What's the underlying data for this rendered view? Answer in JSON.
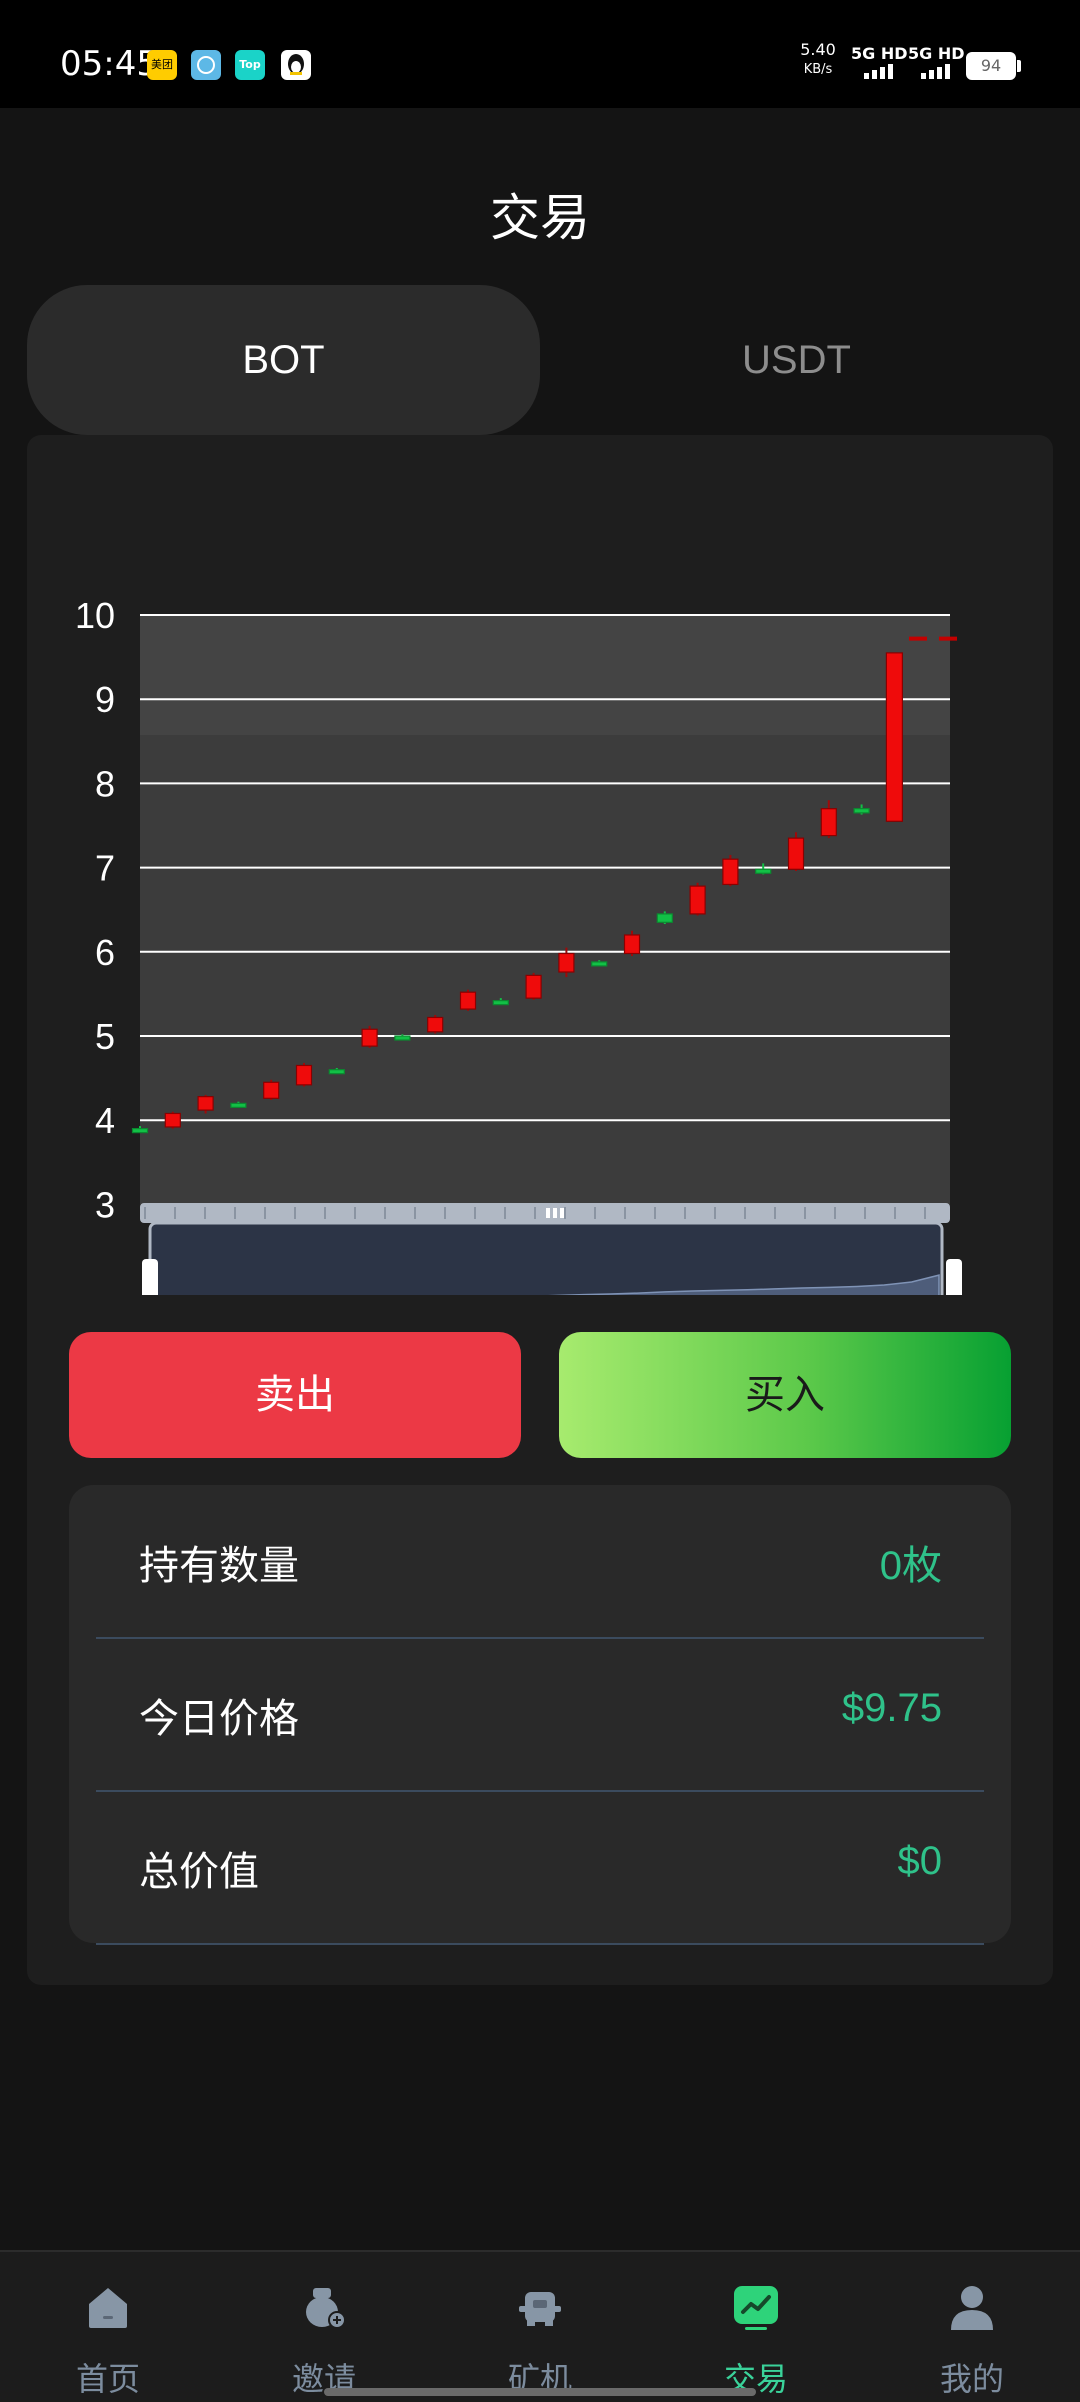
{
  "status_bar": {
    "time": "05:45",
    "apps": [
      "美团",
      "",
      "Top",
      ""
    ],
    "net_speed": "5.40",
    "net_unit": "KB/s",
    "signal1": "5G HD",
    "signal2": "5G HD",
    "battery": "94"
  },
  "header": {
    "title": "交易"
  },
  "tabs": [
    {
      "label": "BOT",
      "active": true
    },
    {
      "label": "USDT",
      "active": false
    }
  ],
  "chart_data": {
    "type": "candlestick",
    "title": "",
    "xlabel": "",
    "ylabel": "",
    "ylim": [
      3,
      10
    ],
    "yticks": [
      10,
      9,
      8,
      7,
      6,
      5,
      4,
      3
    ],
    "grid": true,
    "candles": [
      {
        "open": 3.88,
        "close": 3.9,
        "low": 3.86,
        "high": 3.93,
        "dir": "up"
      },
      {
        "open": 3.92,
        "close": 4.08,
        "low": 3.9,
        "high": 4.1,
        "dir": "down"
      },
      {
        "open": 4.12,
        "close": 4.28,
        "low": 4.08,
        "high": 4.3,
        "dir": "down"
      },
      {
        "open": 4.18,
        "close": 4.2,
        "low": 4.17,
        "high": 4.22,
        "dir": "up"
      },
      {
        "open": 4.26,
        "close": 4.45,
        "low": 4.24,
        "high": 4.48,
        "dir": "down"
      },
      {
        "open": 4.42,
        "close": 4.65,
        "low": 4.4,
        "high": 4.68,
        "dir": "down"
      },
      {
        "open": 4.58,
        "close": 4.6,
        "low": 4.57,
        "high": 4.62,
        "dir": "up"
      },
      {
        "open": 4.88,
        "close": 5.08,
        "low": 4.86,
        "high": 5.12,
        "dir": "down"
      },
      {
        "open": 4.98,
        "close": 5.0,
        "low": 4.97,
        "high": 5.02,
        "dir": "up"
      },
      {
        "open": 5.05,
        "close": 5.22,
        "low": 5.03,
        "high": 5.25,
        "dir": "down"
      },
      {
        "open": 5.32,
        "close": 5.52,
        "low": 5.3,
        "high": 5.55,
        "dir": "down"
      },
      {
        "open": 5.4,
        "close": 5.42,
        "low": 5.39,
        "high": 5.45,
        "dir": "up"
      },
      {
        "open": 5.45,
        "close": 5.72,
        "low": 5.43,
        "high": 5.75,
        "dir": "down"
      },
      {
        "open": 5.76,
        "close": 5.98,
        "low": 5.7,
        "high": 6.05,
        "dir": "down"
      },
      {
        "open": 5.85,
        "close": 5.88,
        "low": 5.84,
        "high": 5.9,
        "dir": "up"
      },
      {
        "open": 5.98,
        "close": 6.2,
        "low": 5.95,
        "high": 6.25,
        "dir": "down"
      },
      {
        "open": 6.35,
        "close": 6.45,
        "low": 6.33,
        "high": 6.48,
        "dir": "up"
      },
      {
        "open": 6.45,
        "close": 6.78,
        "low": 6.43,
        "high": 6.82,
        "dir": "down"
      },
      {
        "open": 6.8,
        "close": 7.1,
        "low": 6.78,
        "high": 7.15,
        "dir": "down"
      },
      {
        "open": 6.95,
        "close": 6.98,
        "low": 6.92,
        "high": 7.05,
        "dir": "up"
      },
      {
        "open": 6.98,
        "close": 7.35,
        "low": 6.96,
        "high": 7.42,
        "dir": "down"
      },
      {
        "open": 7.38,
        "close": 7.7,
        "low": 7.35,
        "high": 7.8,
        "dir": "down"
      },
      {
        "open": 7.65,
        "close": 7.7,
        "low": 7.63,
        "high": 7.75,
        "dir": "up"
      },
      {
        "open": 7.55,
        "close": 9.55,
        "low": 7.55,
        "high": 9.55,
        "dir": "down"
      }
    ],
    "last_price_marker": 9.72,
    "overview_series": [
      0.02,
      0.03,
      0.05,
      0.07,
      0.08,
      0.1,
      0.11,
      0.14,
      0.17,
      0.19,
      0.2,
      0.22,
      0.25,
      0.28,
      0.3,
      0.33,
      0.37,
      0.4,
      0.42,
      0.44,
      0.47,
      0.5,
      0.52,
      0.55,
      0.6,
      0.7,
      0.93
    ]
  },
  "actions": {
    "sell_label": "卖出",
    "buy_label": "买入"
  },
  "info": {
    "rows": [
      {
        "label": "持有数量",
        "value": "0枚"
      },
      {
        "label": "今日价格",
        "value": "$9.75"
      },
      {
        "label": "总价值",
        "value": "$0"
      }
    ]
  },
  "nav": {
    "items": [
      {
        "label": "首页",
        "icon": "home-icon"
      },
      {
        "label": "邀请",
        "icon": "invite-icon"
      },
      {
        "label": "矿机",
        "icon": "miner-icon"
      },
      {
        "label": "交易",
        "icon": "trade-icon",
        "active": true
      },
      {
        "label": "我的",
        "icon": "profile-icon"
      }
    ]
  },
  "colors": {
    "up": "#12c046",
    "down": "#ef0b0b",
    "accent": "#2fc28a",
    "sell": "#ec3945"
  }
}
